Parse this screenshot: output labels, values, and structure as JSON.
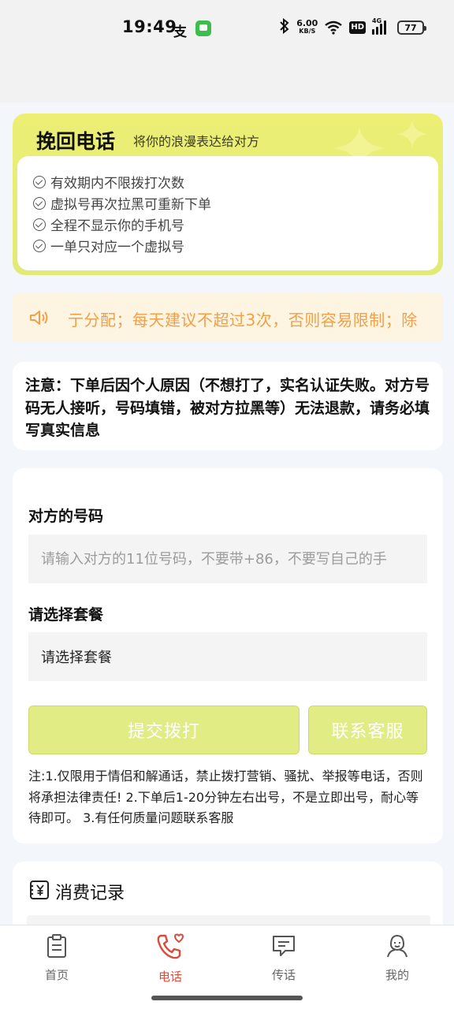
{
  "status_bar": {
    "time": "19:49",
    "notif_alipay": "支",
    "speed_value": "6.00",
    "speed_unit": "KB/S",
    "hd": "HD",
    "signal": "4G",
    "battery": "77"
  },
  "hero": {
    "title": "挽回电话",
    "subtitle": "将你的浪漫表达给对方",
    "features": [
      "有效期内不限拨打次数",
      "虚拟号再次拉黑可重新下单",
      "全程不显示你的手机号",
      "一单只对应一个虚拟号"
    ],
    "accent": "#e6ec74"
  },
  "notice": {
    "text": "亍分配；每天建议不超过3次，否则容易限制；除",
    "color": "#f1a048"
  },
  "attention": {
    "text": "注意：下单后因个人原因（不想打了，实名认证失败。对方号码无人接听，号码填错，被对方拉黑等）无法退款，请务必填写真实信息"
  },
  "form": {
    "phone_label": "对方的号码",
    "phone_placeholder": "请输入对方的11位号码，不要带+86，不要写自己的手",
    "package_label": "请选择套餐",
    "package_value": "请选择套餐",
    "submit_label": "提交拨打",
    "service_label": "联系客服",
    "note": "注:1.仅限用于情侣和解通话，禁止拨打营销、骚扰、举报等电话，否则将承担法律责任! 2.下单后1-20分钟左右出号，不是立即出号，耐心等待即可。 3.有任何质量问题联系客服"
  },
  "record": {
    "title": "消费记录"
  },
  "nav": {
    "items": [
      {
        "label": "首页",
        "icon": "clipboard-icon"
      },
      {
        "label": "电话",
        "icon": "phone-heart-icon",
        "active": true
      },
      {
        "label": "传话",
        "icon": "chat-icon"
      },
      {
        "label": "我的",
        "icon": "user-icon"
      }
    ],
    "active_color": "#d94c3c"
  }
}
